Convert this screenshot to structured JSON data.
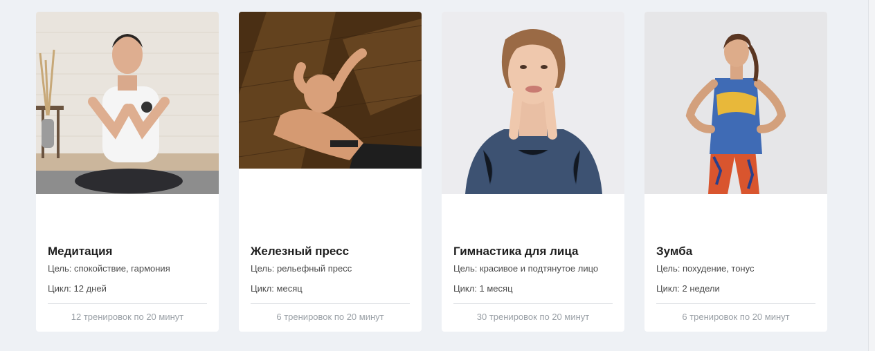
{
  "cards": [
    {
      "title": "Медитация",
      "goal": "Цель: спокойствие, гармония",
      "cycle": "Цикл: 12 дней",
      "sessions": "12 тренировок по 20 минут",
      "image": "meditation-photo"
    },
    {
      "title": "Железный пресс",
      "goal": "Цель: рельефный пресс",
      "cycle": "Цикл: месяц",
      "sessions": "6 тренировок по 20 минут",
      "image": "abs-workout-photo"
    },
    {
      "title": "Гимнастика для лица",
      "goal": "Цель: красивое и подтянутое лицо",
      "cycle": "Цикл: 1 месяц",
      "sessions": "30 тренировок по 20 минут",
      "image": "face-gymnastics-photo"
    },
    {
      "title": "Зумба",
      "goal": "Цель: похудение, тонус",
      "cycle": "Цикл: 2 недели",
      "sessions": "6 тренировок по 20 минут",
      "image": "zumba-photo"
    }
  ],
  "colors": {
    "page_background": "#eef1f5",
    "card_background": "#ffffff",
    "title_text": "#1f1f1f",
    "body_text": "#4a4a4a",
    "muted_text": "#9aa0a6"
  }
}
